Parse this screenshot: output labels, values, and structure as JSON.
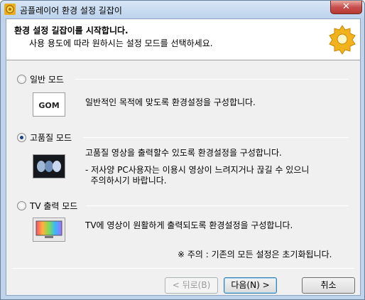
{
  "window": {
    "title": "곰플레이어 환경 설정 길잡이",
    "close_label": "✕"
  },
  "header": {
    "title": "환경 설정 길잡이를 시작합니다.",
    "subtitle": "사용 용도에 따라 원하시는 설정 모드를 선택하세요."
  },
  "modes": [
    {
      "label": "일반 모드",
      "checked": false,
      "icon": "gom-logo-icon",
      "icon_text": "GOM",
      "description": [
        "일반적인 목적에 맞도록 환경설정을 구성합니다."
      ]
    },
    {
      "label": "고품질 모드",
      "checked": true,
      "icon": "high-quality-icon",
      "description": [
        "고품질 영상을 출력할수 있도록 환경설정을 구성합니다.",
        "- 저사양 PC사용자는 이용시 영상이 느려지거나 끊길 수 있으니",
        "  주의하시기 바랍니다."
      ]
    },
    {
      "label": "TV 출력 모드",
      "checked": false,
      "icon": "tv-icon",
      "description": [
        "TV에 영상이 원활하게 출력되도록 환경설정을 구성합니다."
      ]
    }
  ],
  "notice": "※ 주의 : 기존의 모든 설정은 초기화됩니다.",
  "buttons": {
    "back": "< 뒤로(B)",
    "next": "다음(N) >",
    "cancel": "취소"
  }
}
